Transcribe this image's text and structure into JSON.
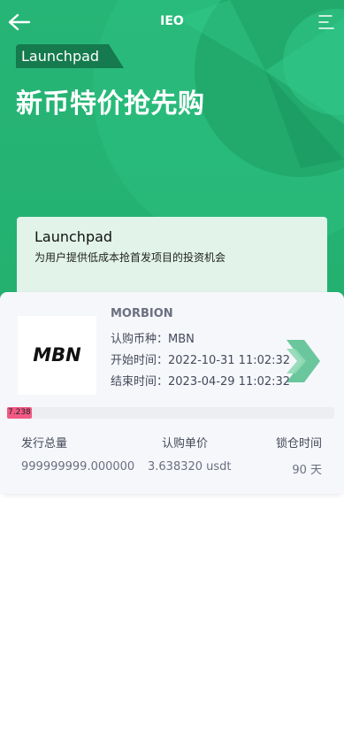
{
  "header": {
    "title": "IEO"
  },
  "hero": {
    "tag": "Launchpad",
    "headline": "新币特价抢先购"
  },
  "intro": {
    "title": "Launchpad",
    "subtitle": "为用户提供低成本抢首发项目的投资机会"
  },
  "project": {
    "name": "MORBION",
    "logo_text": "MBN",
    "currency": "认购币种：MBN",
    "start": "开始时间：2022-10-31 11:02:32",
    "end": "结束时间：2023-04-29 11:02:32",
    "progress_label": "7.238",
    "progress_fraction": 0.07238,
    "stats": {
      "total_label": "发行总量",
      "price_label": "认购单价",
      "lock_label": "锁仓时间",
      "total_value": "999999999.000000",
      "price_value": "3.638320 usdt",
      "lock_value": "90 天"
    }
  },
  "icons": {
    "back": "arrow-left-icon",
    "menu": "menu-icon",
    "go": "double-chevron-right-icon"
  },
  "colors": {
    "hero_green": "#27b577",
    "tag_green": "#157a4d",
    "intro_bg": "#e2f4ea",
    "progress_pink": "#f25a84"
  }
}
